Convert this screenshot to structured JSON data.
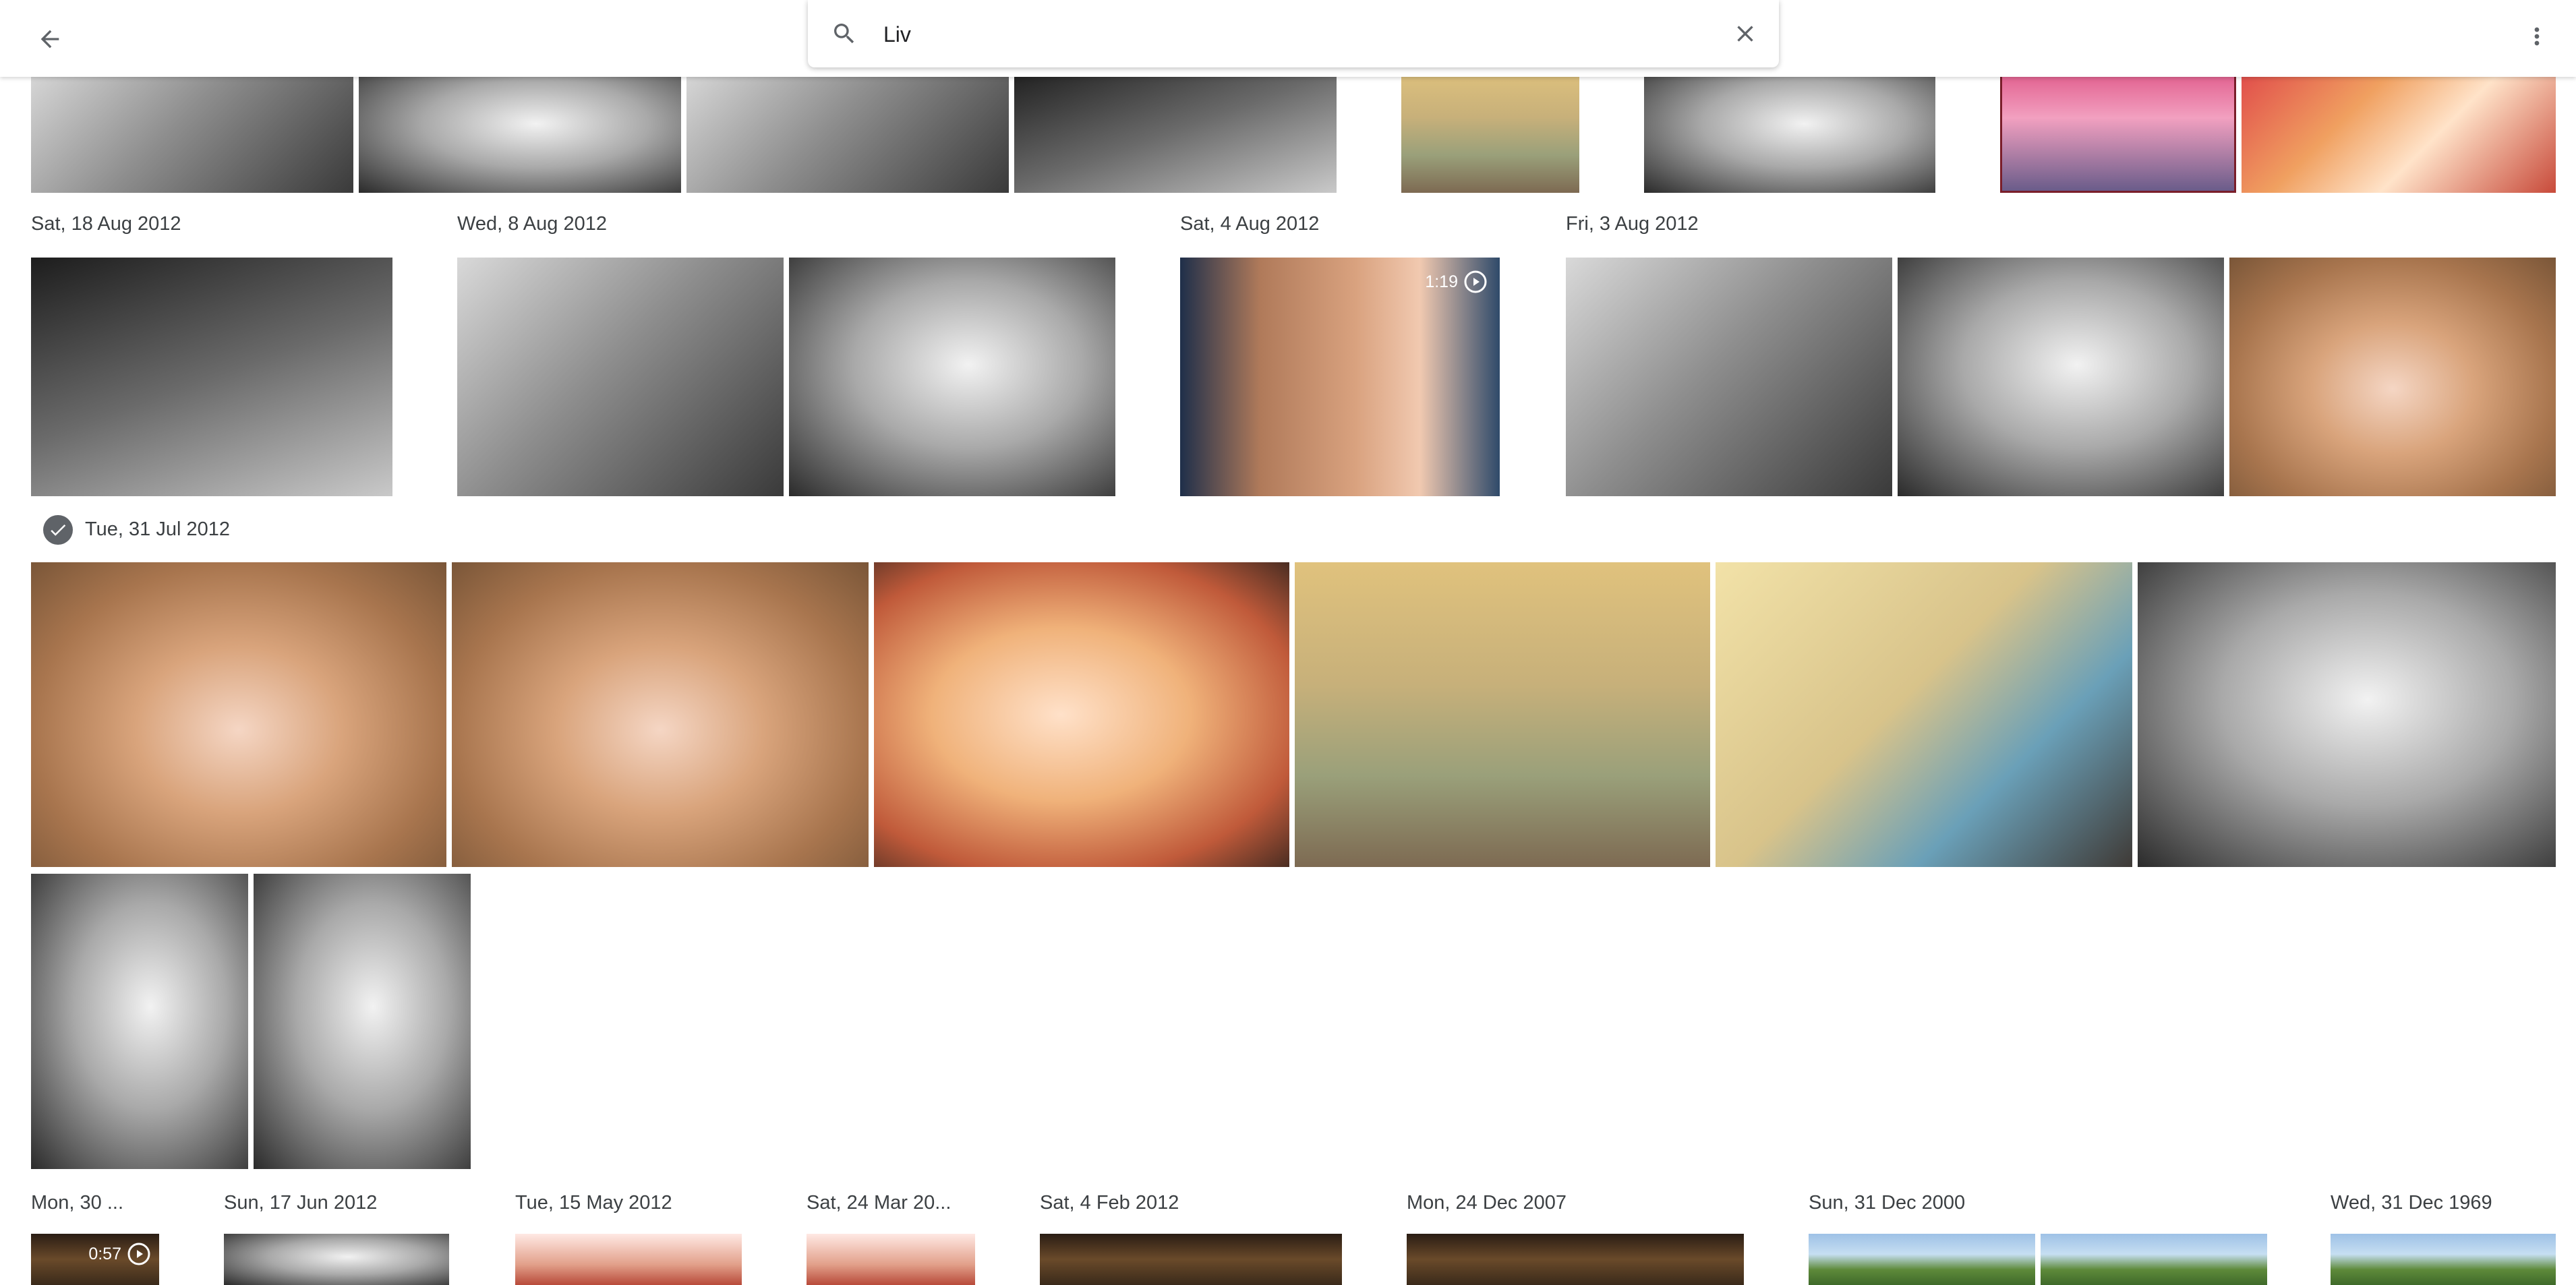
{
  "header": {
    "search_value": "Liv",
    "back_icon": "arrow-back-icon",
    "search_icon": "search-icon",
    "clear_icon": "close-icon",
    "menu_icon": "more-vert-icon"
  },
  "dates": {
    "d1": "Sat, 18 Aug 2012",
    "d2": "Wed, 8 Aug 2012",
    "d3": "Sat, 4 Aug 2012",
    "d4": "Fri, 3 Aug 2012",
    "d5": "Tue, 31 Jul 2012",
    "d6": "Mon, 30 ...",
    "d7": "Sun, 17 Jun 2012",
    "d8": "Tue, 15 May 2012",
    "d9": "Sat, 24 Mar 20...",
    "d10": "Sat, 4 Feb 2012",
    "d11": "Mon, 24 Dec 2007",
    "d12": "Sun, 31 Dec 2000",
    "d13": "Wed, 31 Dec 1969"
  },
  "videos": {
    "v1": "1:19",
    "v2": "0:57"
  },
  "colors": {
    "topbar_bg": "#ffffff",
    "label_text": "#3c4043",
    "check_bg": "#5f6368"
  }
}
